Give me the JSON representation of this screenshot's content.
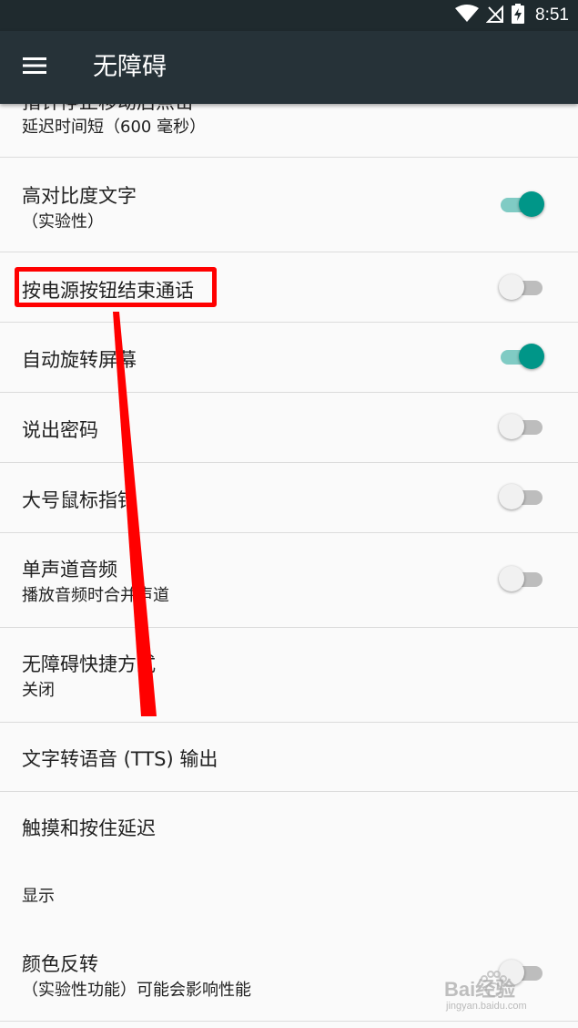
{
  "status_bar": {
    "time": "8:51",
    "icons": [
      "wifi-icon",
      "no-signal-icon",
      "battery-charging-icon"
    ]
  },
  "app_bar": {
    "menu_icon": "menu-icon",
    "title": "无障碍"
  },
  "settings": {
    "partial_item": {
      "title": "指针停止移动后点击",
      "summary": "延迟时间短（600 毫秒）"
    },
    "high_contrast": {
      "title": "高对比度文字",
      "summary": "（实验性）",
      "enabled": true
    },
    "power_button_ends_call": {
      "title": "按电源按钮结束通话",
      "enabled": false
    },
    "auto_rotate": {
      "title": "自动旋转屏幕",
      "enabled": true
    },
    "speak_passwords": {
      "title": "说出密码",
      "enabled": false
    },
    "large_pointer": {
      "title": "大号鼠标指针",
      "enabled": false
    },
    "mono_audio": {
      "title": "单声道音频",
      "summary": "播放音频时合并声道",
      "enabled": false
    },
    "shortcut": {
      "title": "无障碍快捷方式",
      "summary": "关闭"
    },
    "tts": {
      "title": "文字转语音 (TTS) 输出"
    },
    "touch_hold_delay": {
      "title": "触摸和按住延迟"
    },
    "display_section": {
      "header": "显示"
    },
    "color_inversion": {
      "title": "颜色反转",
      "summary": "（实验性功能）可能会影响性能",
      "enabled": false
    }
  },
  "annotation": {
    "highlight_color": "#ff0000"
  },
  "watermark": {
    "brand": "Bai经验",
    "url": "jingyan.baidu.com"
  },
  "colors": {
    "app_bar": "#263238",
    "status_bar": "#1f2a2e",
    "switch_on_thumb": "#009688",
    "switch_on_track": "#80cbc4"
  }
}
